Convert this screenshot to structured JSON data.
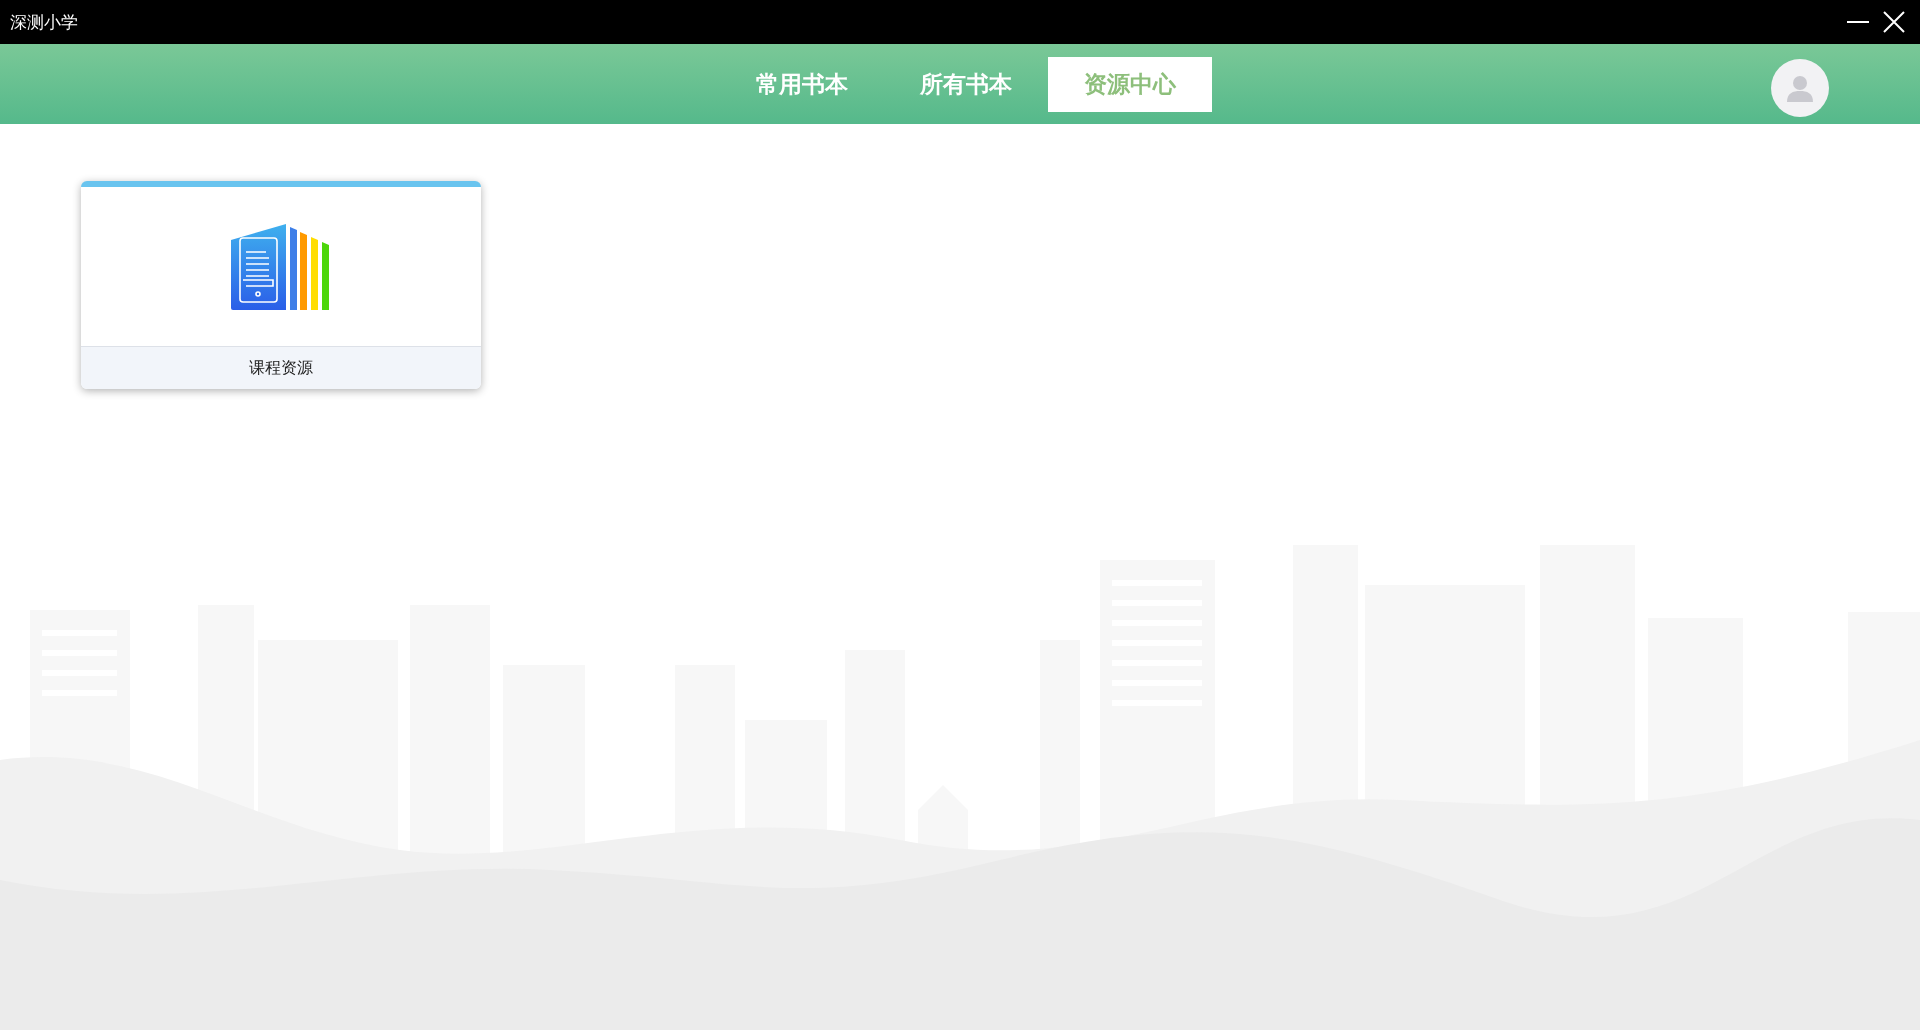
{
  "window": {
    "title": "深测小学"
  },
  "tabs": [
    {
      "label": "常用书本",
      "selected": false
    },
    {
      "label": "所有书本",
      "selected": false
    },
    {
      "label": "资源中心",
      "selected": true
    }
  ],
  "cards": [
    {
      "label": "课程资源"
    }
  ]
}
